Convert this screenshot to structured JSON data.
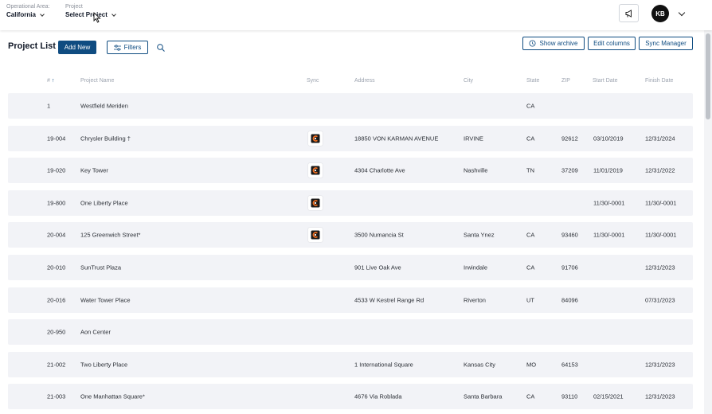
{
  "header": {
    "operational_area": {
      "label": "Operational Area:",
      "value": "California"
    },
    "project": {
      "label": "Project",
      "value": "Select Project"
    },
    "user_initials": "KB"
  },
  "toolbar": {
    "title": "Project List",
    "add_new": "Add New",
    "filters": "Filters",
    "show_archive": "Show archive",
    "edit_columns": "Edit columns",
    "sync_manager": "Sync Manager"
  },
  "table": {
    "headers": {
      "num": "#",
      "name": "Project Name",
      "sync": "Sync",
      "address": "Address",
      "city": "City",
      "state": "State",
      "zip": "ZIP",
      "start": "Start Date",
      "finish": "Finish Date"
    },
    "rows": [
      {
        "num": "1",
        "name": "Westfield Meriden",
        "sync": false,
        "address": "",
        "city": "",
        "state": "CA",
        "zip": "",
        "start": "",
        "finish": ""
      },
      {
        "num": "19-004",
        "name": "Chrysler Building †",
        "sync": true,
        "address": "18850 VON KARMAN AVENUE",
        "city": "IRVINE",
        "state": "CA",
        "zip": "92612",
        "start": "03/10/2019",
        "finish": "12/31/2024"
      },
      {
        "num": "19-020",
        "name": "Key Tower",
        "sync": true,
        "address": "4304 Charlotte Ave",
        "city": "Nashville",
        "state": "TN",
        "zip": "37209",
        "start": "11/01/2019",
        "finish": "12/31/2022"
      },
      {
        "num": "19-800",
        "name": "One Liberty Place",
        "sync": true,
        "address": "",
        "city": "",
        "state": "",
        "zip": "",
        "start": "11/30/-0001",
        "finish": "11/30/-0001"
      },
      {
        "num": "20-004",
        "name": "125 Greenwich Street*",
        "sync": true,
        "address": "3500 Numancia St",
        "city": "Santa Ynez",
        "state": "CA",
        "zip": "93460",
        "start": "11/30/-0001",
        "finish": "11/30/-0001"
      },
      {
        "num": "20-010",
        "name": "SunTrust Plaza",
        "sync": false,
        "address": "901 Live Oak Ave",
        "city": "Irwindale",
        "state": "CA",
        "zip": "91706",
        "start": "",
        "finish": "12/31/2023"
      },
      {
        "num": "20-016",
        "name": "Water Tower Place",
        "sync": false,
        "address": "4533 W Kestrel Range Rd",
        "city": "Riverton",
        "state": "UT",
        "zip": "84096",
        "start": "",
        "finish": "07/31/2023"
      },
      {
        "num": "20-950",
        "name": "Aon Center",
        "sync": false,
        "address": "",
        "city": "",
        "state": "",
        "zip": "",
        "start": "",
        "finish": ""
      },
      {
        "num": "21-002",
        "name": "Two Liberty Place",
        "sync": false,
        "address": "1 International Square",
        "city": "Kansas City",
        "state": "MO",
        "zip": "64153",
        "start": "",
        "finish": "12/31/2023"
      },
      {
        "num": "21-003",
        "name": "One Manhattan Square*",
        "sync": false,
        "address": "4676 Via Roblada",
        "city": "Santa Barbara",
        "state": "CA",
        "zip": "93110",
        "start": "02/15/2021",
        "finish": "12/31/2023"
      }
    ]
  },
  "colors": {
    "brand": "#0f4c81",
    "row_bg": "#f2f3f7",
    "header_text": "#9ca3af"
  }
}
